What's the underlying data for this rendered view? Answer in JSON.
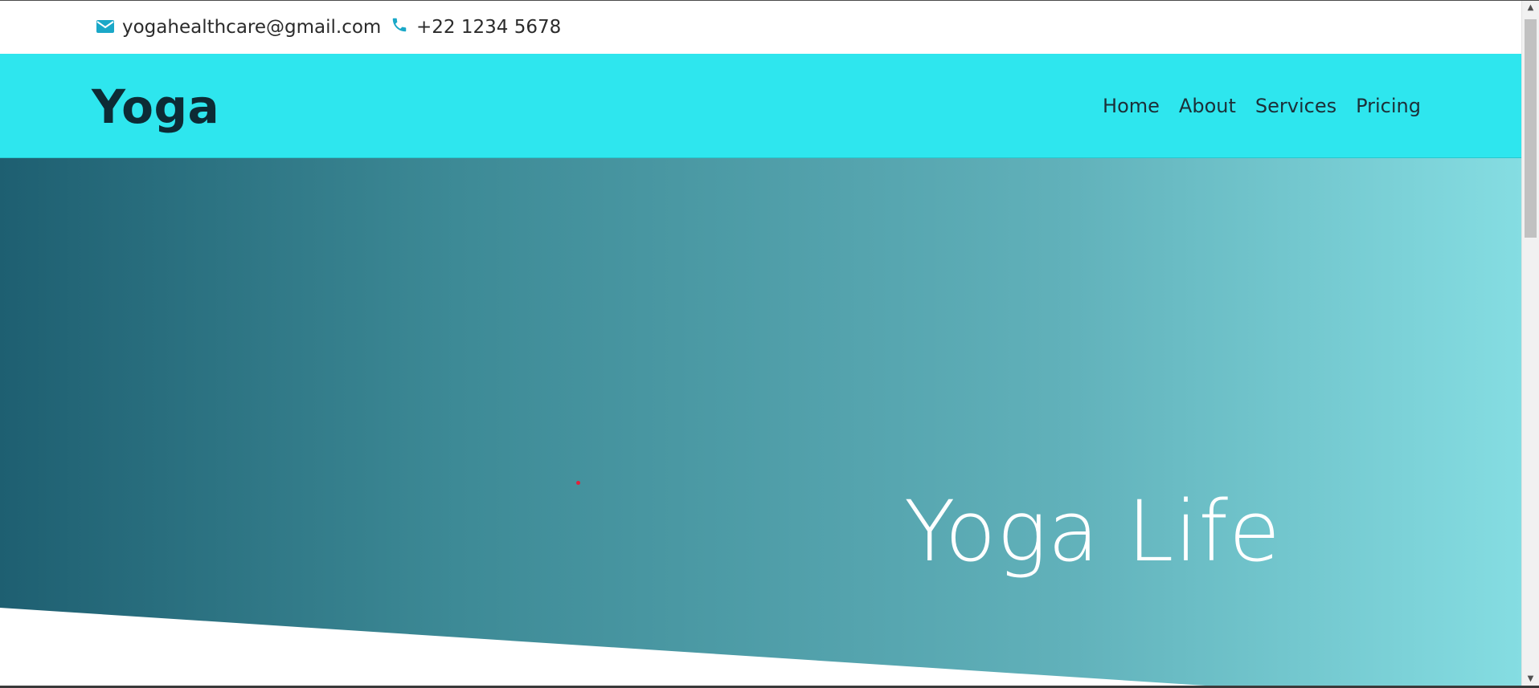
{
  "topbar": {
    "email": "yogahealthcare@gmail.com",
    "phone": "+22 1234 5678",
    "email_icon": "envelope-icon",
    "phone_icon": "phone-icon"
  },
  "navbar": {
    "logo": "Yoga",
    "items": [
      {
        "label": "Home"
      },
      {
        "label": "About"
      },
      {
        "label": "Services"
      },
      {
        "label": "Pricing"
      }
    ]
  },
  "hero": {
    "title": "Yoga Life"
  },
  "colors": {
    "icon": "#1aa8c8",
    "navbar_bg": "#2ee6ee",
    "hero_gradient_start": "#1e5f71",
    "hero_gradient_end": "#85dde2",
    "logo_text": "#0d2b35"
  }
}
